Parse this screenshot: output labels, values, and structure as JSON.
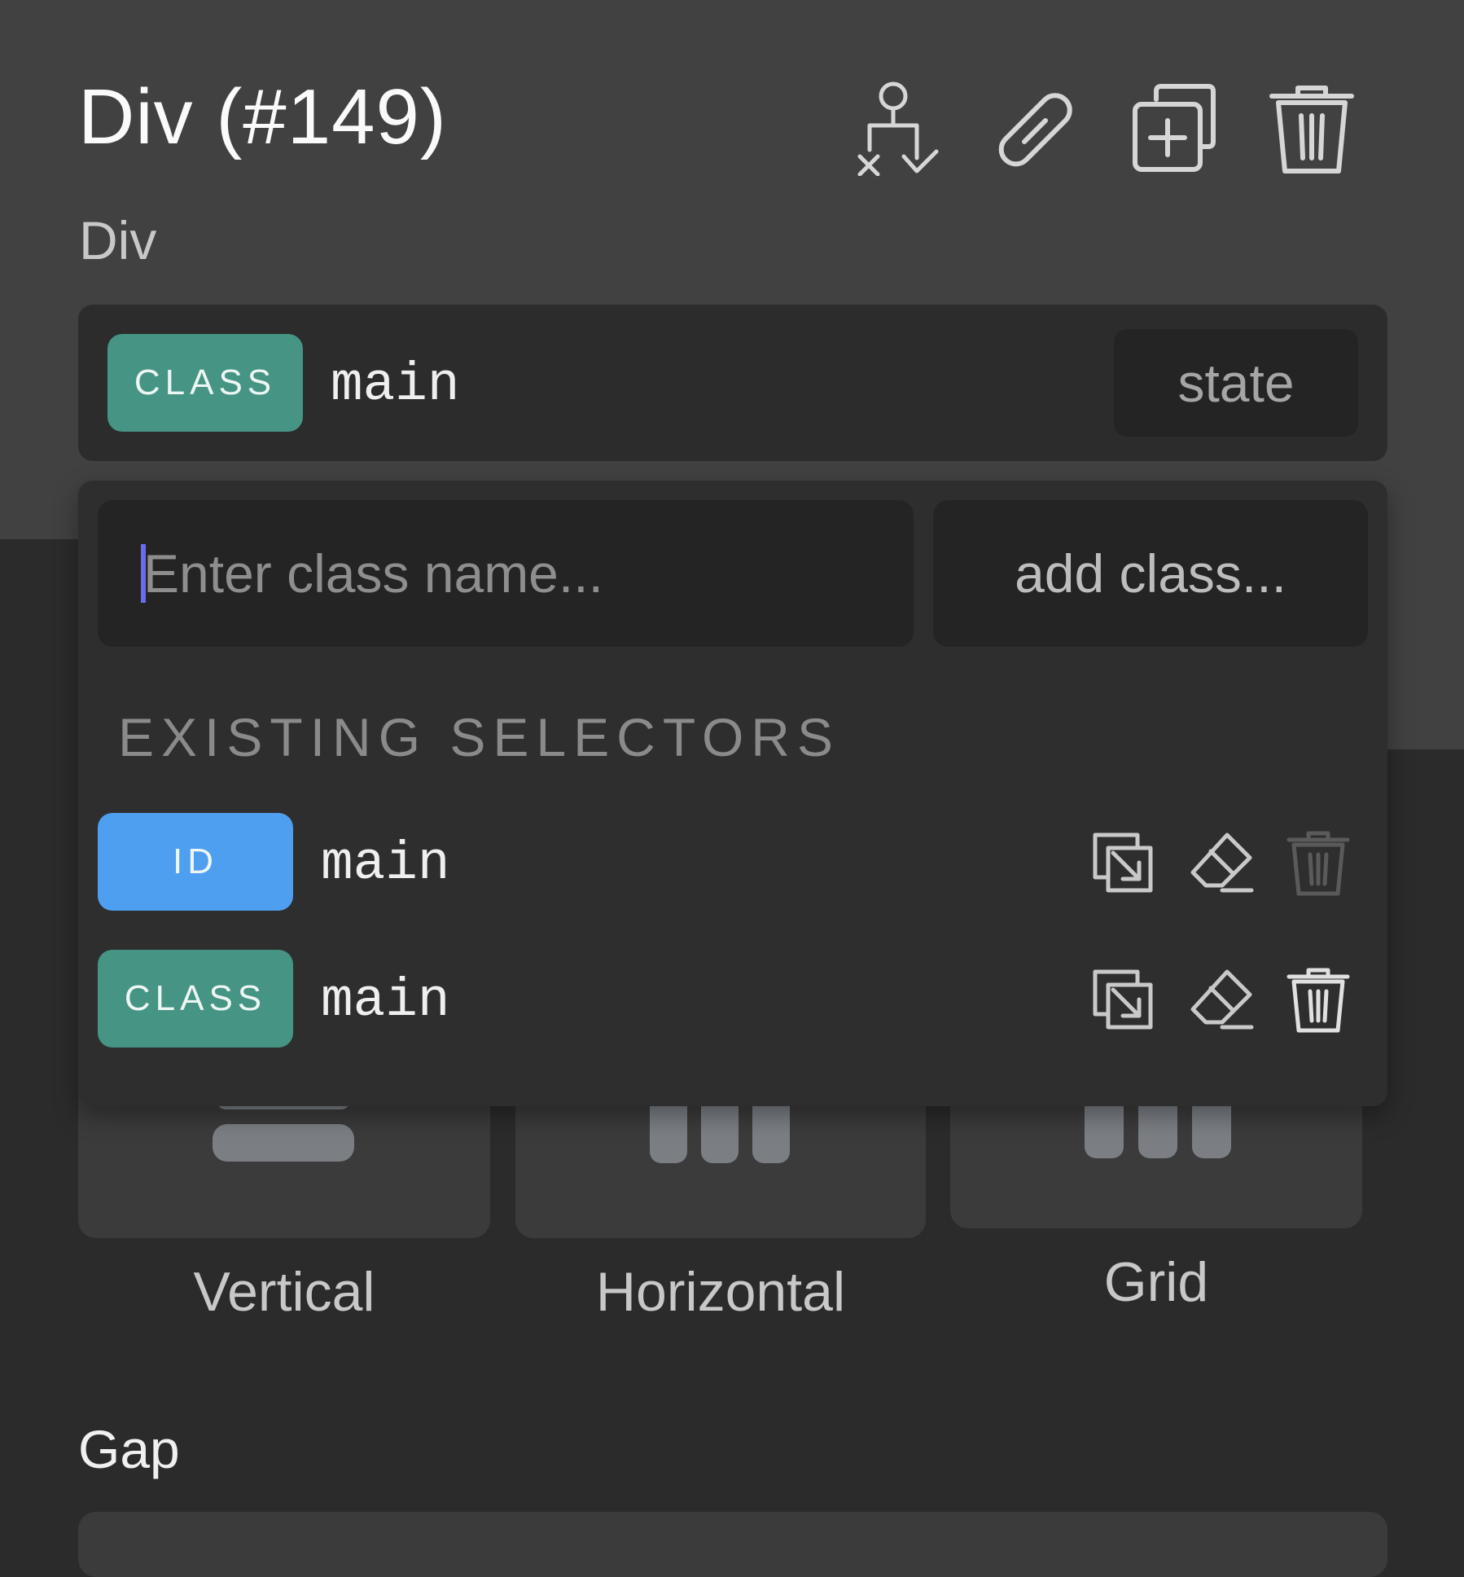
{
  "header": {
    "title": "Div (#149)",
    "subtitle": "Div",
    "actions": [
      {
        "name": "reparent-icon"
      },
      {
        "name": "link-icon"
      },
      {
        "name": "duplicate-icon"
      },
      {
        "name": "trash-icon"
      }
    ]
  },
  "selector": {
    "type_label": "CLASS",
    "name": "main",
    "state_label": "state"
  },
  "class_dropdown": {
    "input_placeholder": "Enter class name...",
    "add_button_label": "add class...",
    "section_label": "EXISTING SELECTORS",
    "existing": [
      {
        "type": "ID",
        "name": "main",
        "color": "#4f9ff0",
        "delete_enabled": false
      },
      {
        "type": "CLASS",
        "name": "main",
        "color": "#459484",
        "delete_enabled": true
      }
    ]
  },
  "layout": {
    "options": [
      {
        "label": "Vertical"
      },
      {
        "label": "Horizontal"
      },
      {
        "label": "Grid"
      }
    ]
  },
  "gap": {
    "label": "Gap"
  },
  "colors": {
    "class_badge": "#459484",
    "id_badge": "#4f9ff0",
    "caret": "#6a6cf0",
    "panel_bg": "#414141",
    "dark_bg": "#2b2b2b"
  }
}
